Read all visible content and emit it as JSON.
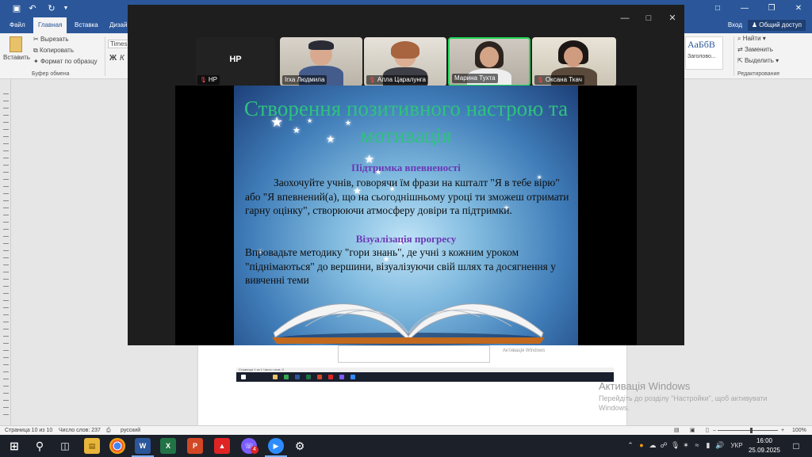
{
  "word": {
    "tabs": [
      "Файл",
      "Главная",
      "Вставка",
      "Дизай"
    ],
    "login": "Вход",
    "share": "Общий доступ",
    "ribbon": {
      "paste": "Вставить",
      "cut": "Вырезать",
      "copy": "Копировать",
      "format_painter": "Формат по образцу",
      "clipboard_group": "Буфер обмена",
      "font_name": "Times N",
      "bold": "Ж",
      "italic": "К",
      "styles_sample": "АаБбВ",
      "styles_name": "Заголово...",
      "find": "Найти",
      "replace": "Заменить",
      "select": "Выделить",
      "editing_group": "Редактирование"
    },
    "status": {
      "page": "Страница 10 из 10",
      "words": "Число слов: 237",
      "language": "русский",
      "zoom": "100%"
    },
    "embedded": {
      "status": "Страница 1 из 1   Число слов: 0",
      "watermark": "Активація Windows"
    }
  },
  "activation": {
    "title": "Активація Windows",
    "subtitle": "Перейдіть до розділу \"Настройки\", щоб активувати Windows."
  },
  "zoom": {
    "participants": [
      {
        "name": "НР",
        "initials": "НР"
      },
      {
        "name": "Іrxa Людмила"
      },
      {
        "name": "Алла Царалунга"
      },
      {
        "name": "Марина Тухта"
      },
      {
        "name": "Оксана Ткач"
      }
    ],
    "active_speaker_color": "#23d959"
  },
  "slide": {
    "title": "Створення позитивного настрою та мотивація",
    "section1_title": "Підтримка впевненості",
    "section1_body": "Заохочуйте учнів, говорячи їм фрази на кшталт \"Я в тебе вірю\" або \"Я впевнений(а), що на сьогоднішньому уроці ти зможеш отримати гарну оцінку\", створюючи атмосферу довіри та підтримки.",
    "section2_title": "Візуалізація прогресу",
    "section2_body": "Впровадьте методику \"гори знань\", де учні з кожним уроком \"піднімаються\" до вершини, візуалізуючи свій шлях та досягнення у вивченні теми",
    "title_color": "#2ec27e",
    "heading_color": "#6a38b5"
  },
  "taskbar": {
    "language": "УКР",
    "time": "16:00",
    "date": "25.09.2025",
    "badge_count": "4"
  }
}
